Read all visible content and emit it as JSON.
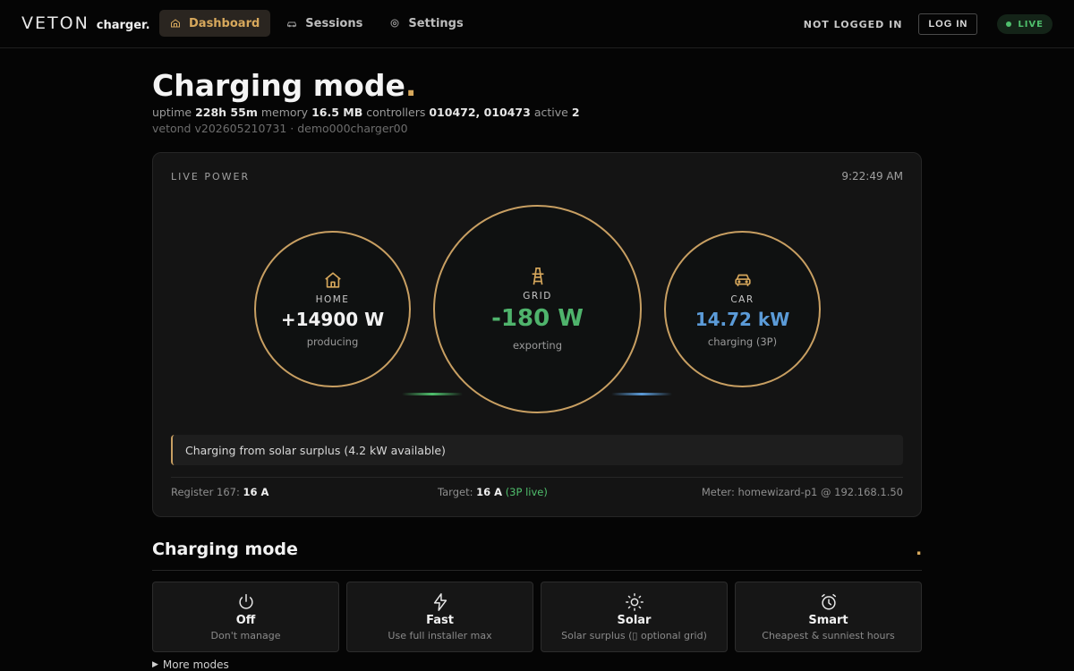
{
  "header": {
    "logo_brand": "VETON",
    "logo_sub": "charger.",
    "nav": [
      {
        "label": "Dashboard",
        "icon": "home-icon",
        "active": true
      },
      {
        "label": "Sessions",
        "icon": "car-icon",
        "active": false
      },
      {
        "label": "Settings",
        "icon": "gear-icon",
        "active": false
      }
    ],
    "auth_status": "NOT LOGGED IN",
    "login_label": "LOG IN",
    "live_label": "LIVE"
  },
  "page": {
    "title": "Charging mode",
    "title_dot": ".",
    "meta": {
      "uptime_label": "uptime",
      "uptime": "228h 55m",
      "memory_label": "memory",
      "memory": "16.5 MB",
      "controllers_label": "controllers",
      "controllers": "010472, 010473",
      "active_label": "active",
      "active": "2"
    },
    "version": "vetond v202605210731 · demo000charger00"
  },
  "live_power": {
    "label": "LIVE POWER",
    "time": "9:22:49 AM",
    "home": {
      "label": "HOME",
      "value": "+14900 W",
      "sub": "producing"
    },
    "grid": {
      "label": "GRID",
      "value": "-180 W",
      "sub": "exporting"
    },
    "car": {
      "label": "CAR",
      "value": "14.72 kW",
      "sub": "charging (3P)"
    },
    "banner": "Charging from solar surplus (4.2 kW available)",
    "register_label": "Register 167:",
    "register_value": "16 A",
    "target_label": "Target:",
    "target_value": "16 A",
    "target_note": "(3P live)",
    "meter": "Meter: homewizard-p1 @ 192.168.1.50"
  },
  "modes_section": {
    "title": "Charging mode",
    "dot": ".",
    "modes": [
      {
        "title": "Off",
        "desc": "Don't manage",
        "icon": "power-icon"
      },
      {
        "title": "Fast",
        "desc": "Use full installer max",
        "icon": "bolt-icon"
      },
      {
        "title": "Solar",
        "desc": "Solar surplus (▯ optional grid)",
        "icon": "sun-icon"
      },
      {
        "title": "Smart",
        "desc": "Cheapest & sunniest hours",
        "icon": "alarm-clock-icon"
      }
    ],
    "more_label": "More modes"
  },
  "colors": {
    "accent": "#d7a85c",
    "green": "#4fbf6c",
    "blue": "#5b9bd8",
    "background": "#050505",
    "card": "#141414"
  }
}
